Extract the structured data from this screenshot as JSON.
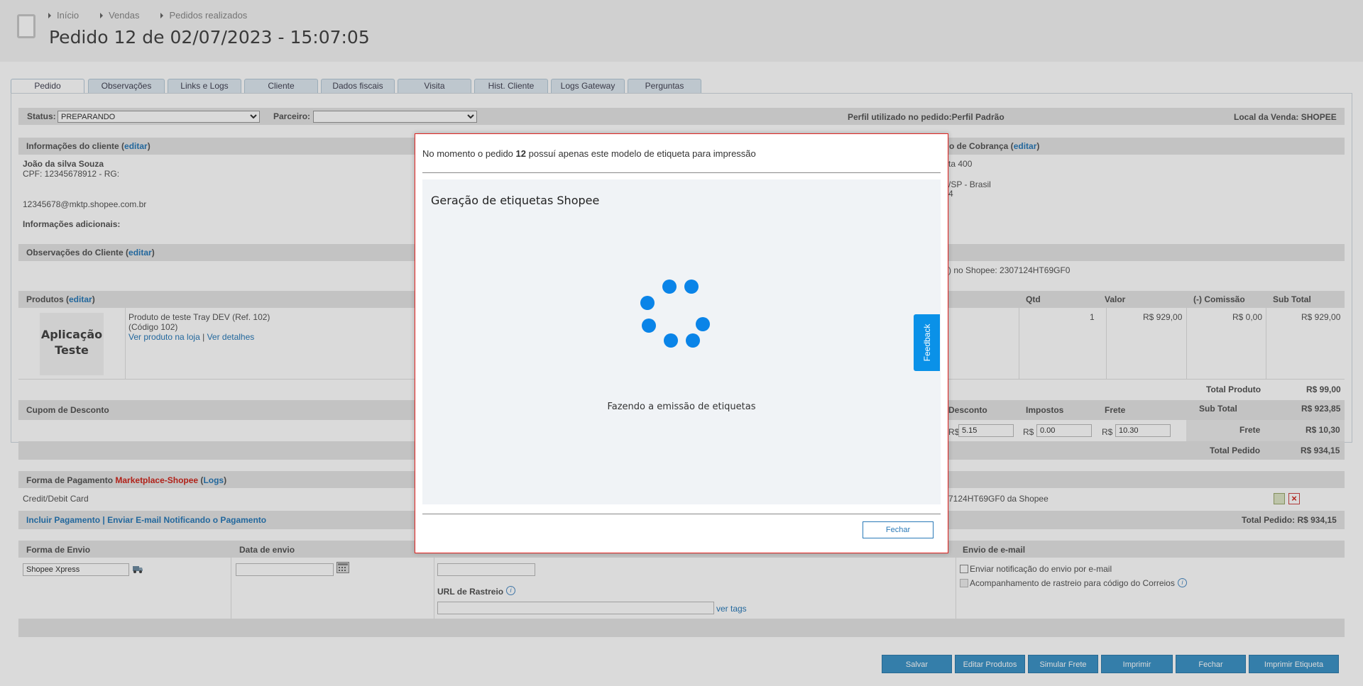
{
  "header": {
    "breadcrumb": [
      "Início",
      "Vendas",
      "Pedidos realizados"
    ],
    "title": "Pedido 12 de 02/07/2023 - 15:07:05"
  },
  "tabs": [
    "Pedido",
    "Observações",
    "Links e Logs",
    "Cliente",
    "Dados fiscais",
    "Visita",
    "Hist. Cliente",
    "Logs Gateway",
    "Perguntas"
  ],
  "status_row": {
    "status_label": "Status:",
    "status_value": "PREPARANDO",
    "parceiro_label": "Parceiro:",
    "parceiro_value": "",
    "perfil": "Perfil utilizado no pedido:Perfil Padrão",
    "local": "Local da Venda: SHOPEE"
  },
  "cliente": {
    "header": "Informações do cliente (",
    "edit": "editar",
    "close": ")",
    "name": "João da silva Souza",
    "cpf": "CPF: 12345678912 - RG:",
    "email": "12345678@mktp.shopee.com.br",
    "adicionais": "Informações adicionais:"
  },
  "cobranca": {
    "header_partial": "o de Cobrança (",
    "edit": "editar",
    "close": ")",
    "line1": "ta 400",
    "line2": "/SP - Brasil",
    "line3": "4"
  },
  "obs_cliente": {
    "header": "Observações do Cliente (",
    "edit": "editar",
    "close": ")",
    "right": ") no Shopee: 2307124HT69GF0"
  },
  "produtos": {
    "header": "Produtos (",
    "edit": "editar",
    "close": ")",
    "thumb_line1": "Aplicação",
    "thumb_line2": "Teste",
    "name": "Produto de teste Tray DEV (Ref. 102)",
    "code": "(Código 102)",
    "link1": "Ver produto na loja",
    "sep": "|",
    "link2": "Ver detalhes",
    "columns": [
      "Qtd",
      "Valor",
      "(-) Comissão",
      "Sub Total"
    ],
    "row": [
      "1",
      "R$ 929,00",
      "R$ 0,00",
      "R$ 929,00"
    ],
    "total_produto_label": "Total Produto",
    "total_produto": "R$ 99,00"
  },
  "cupom": {
    "header": "Cupom de Desconto",
    "desconto_label": "Desconto",
    "impostos_label": "Impostos",
    "frete_label": "Frete",
    "currency": "R$",
    "desconto_value": "5.15",
    "impostos_value": "0.00",
    "frete_value": "10.30",
    "subtotal_label": "Sub Total",
    "subtotal": "R$ 923,85",
    "frete_total_label": "Frete",
    "frete_total": "R$ 10,30",
    "total_pedido_label": "Total Pedido",
    "total_pedido": "R$ 934,15"
  },
  "pagamento": {
    "header": "Forma de Pagamento ",
    "method": "Marketplace-Shopee",
    "logs_open": " (",
    "logs": "Logs",
    "logs_close": ")",
    "card": "Credit/Debit Card",
    "right": "7124HT69GF0 da Shopee",
    "incluir": "Incluir Pagamento",
    "sep": "|",
    "enviar": "Enviar E-mail Notificando o Pagamento",
    "total": "Total Pedido: R$ 934,15"
  },
  "envio": {
    "forma_header": "Forma de Envio",
    "data_header": "Data de envio",
    "email_header": "Envio de e-mail",
    "forma_value": "Shopee Xpress",
    "data_value": "",
    "rastreio_label": "URL de Rastreio",
    "ver_tags": "ver tags",
    "notif": "Enviar notificação do envio por e-mail",
    "acomp": "Acompanhamento de rastreio para código do Correios"
  },
  "buttons": [
    "Salvar",
    "Editar Produtos",
    "Simular Frete",
    "Imprimir",
    "Fechar",
    "Imprimir Etiqueta"
  ],
  "modal": {
    "msg_pre": "No momento o pedido ",
    "msg_num": "12",
    "msg_post": " possuí apenas este modelo de etiqueta para impressão",
    "inner_title": "Geração de etiquetas Shopee",
    "loading": "Fazendo a emissão de etiquetas",
    "close": "Fechar"
  },
  "feedback": "Feedback",
  "colors": {
    "accent": "#3d94c7",
    "spinner": "#0a84e8",
    "modal_border": "#e0221f",
    "feedback": "#0a91e8"
  }
}
